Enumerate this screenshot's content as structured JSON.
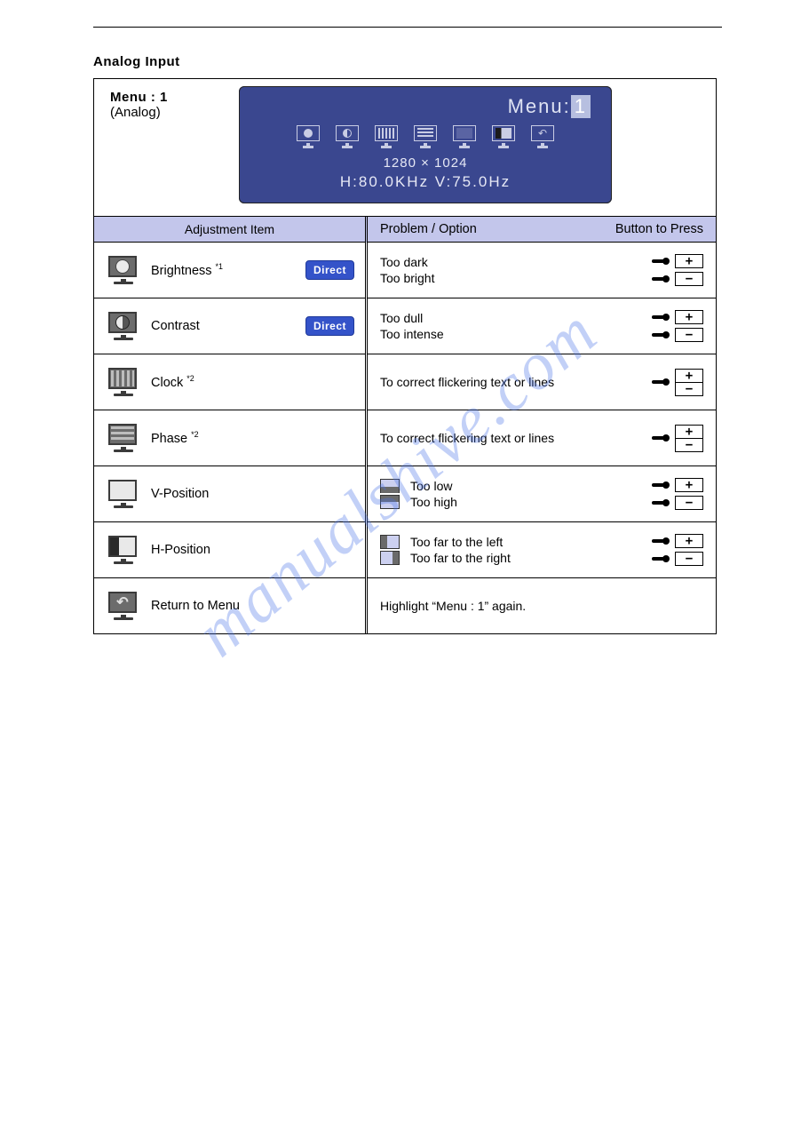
{
  "section_title": "Analog Input",
  "osd": {
    "left_title": "Menu : 1",
    "left_sub": "(Analog)",
    "panel_title_prefix": "Menu:",
    "panel_title_num": "1",
    "resolution": "1280 × 1024",
    "freq": "H:80.0KHz   V:75.0Hz"
  },
  "headers": {
    "adjustment": "Adjustment Item",
    "problem": "Problem / Option",
    "button": "Button to Press"
  },
  "direct_label": "Direct",
  "rows": {
    "brightness": {
      "label": "Brightness ",
      "sup": "*1",
      "p1": "Too dark",
      "p2": "Too bright"
    },
    "contrast": {
      "label": "Contrast",
      "p1": "Too dull",
      "p2": "Too intense"
    },
    "clock": {
      "label": "Clock ",
      "sup": "*2",
      "p1": "To correct flickering text or lines"
    },
    "phase": {
      "label": "Phase ",
      "sup": "*2",
      "p1": "To correct flickering text or lines"
    },
    "vpos": {
      "label": "V-Position",
      "p1": "Too low",
      "p2": "Too high"
    },
    "hpos": {
      "label": "H-Position",
      "p1": "Too far to the left",
      "p2": "Too far to the right"
    },
    "return": {
      "label": "Return to Menu",
      "p1": "Highlight “Menu : 1” again."
    }
  },
  "watermark": "manualshive.com"
}
